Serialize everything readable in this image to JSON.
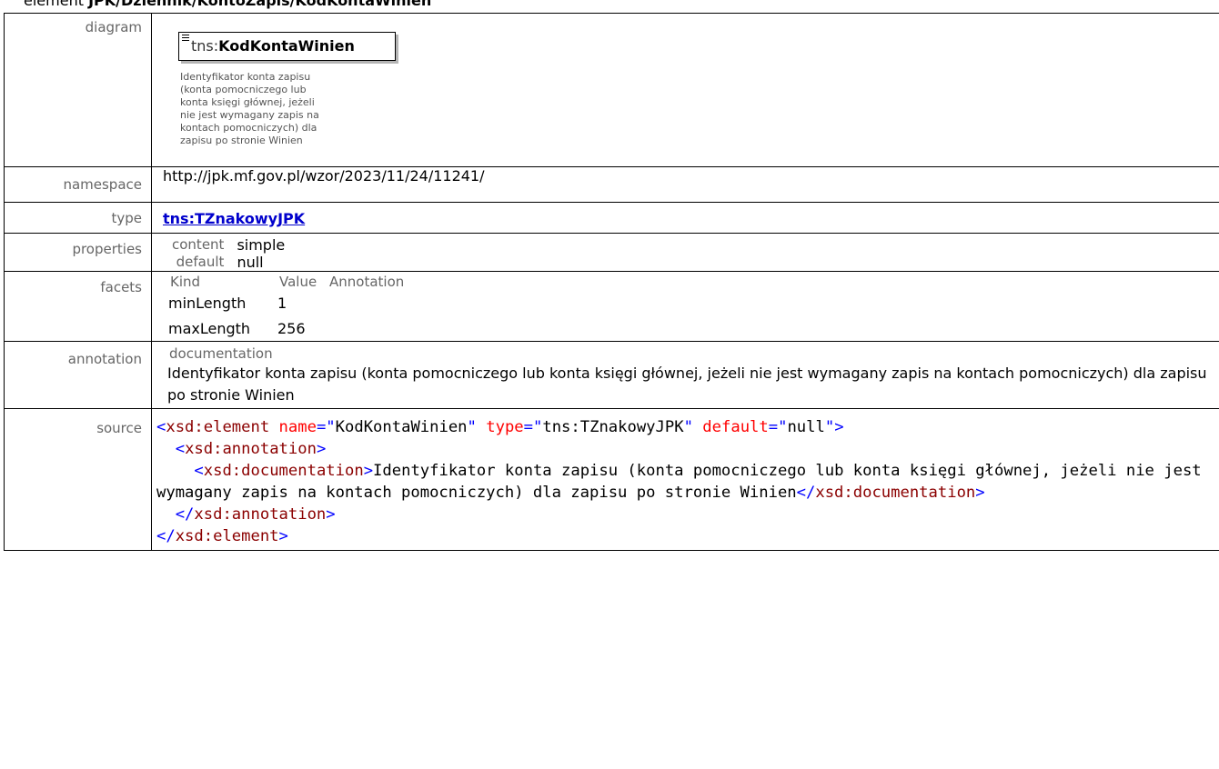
{
  "header": {
    "prefix": "element ",
    "path": "JPK/Dziennik/KontoZapis/KodKontaWinien"
  },
  "labels": {
    "diagram": "diagram",
    "namespace": "namespace",
    "type": "type",
    "properties": "properties",
    "facets": "facets",
    "annotation": "annotation",
    "source": "source"
  },
  "diagram": {
    "prefix": "tns:",
    "name": "KodKontaWinien",
    "doc_lines": [
      "Identyfikator konta zapisu",
      "(konta pomocniczego lub",
      "konta księgi głównej, jeżeli",
      "nie jest wymagany zapis na",
      "kontach pomocniczych) dla",
      "zapisu po stronie Winien"
    ]
  },
  "namespace": "http://jpk.mf.gov.pl/wzor/2023/11/24/11241/",
  "type": "tns:TZnakowyJPK",
  "properties": [
    {
      "key": "content",
      "value": "simple"
    },
    {
      "key": "default",
      "value": "null"
    }
  ],
  "facets": {
    "headers": [
      "Kind",
      "Value",
      "Annotation"
    ],
    "rows": [
      {
        "kind": "minLength",
        "value": "1",
        "annotation": ""
      },
      {
        "kind": "maxLength",
        "value": "256",
        "annotation": ""
      }
    ]
  },
  "annotation": {
    "heading": "documentation",
    "text": "Identyfikator konta zapisu (konta pomocniczego lub konta księgi głównej, jeżeli nie jest wymagany zapis na kontach pomocniczych) dla zapisu po stronie Winien"
  },
  "source": {
    "element_tag": "xsd:element",
    "attr_name": "name",
    "attr_name_value": "KodKontaWinien",
    "attr_type": "type",
    "attr_type_value": "tns:TZnakowyJPK",
    "attr_default": "default",
    "attr_default_value": "null",
    "annotation_tag": "xsd:annotation",
    "documentation_tag": "xsd:documentation",
    "documentation_text": "Identyfikator konta zapisu (konta pomocniczego lub konta księgi głównej, jeżeli nie jest wymagany zapis na kontach pomocniczych) dla zapisu po stronie Winien"
  }
}
